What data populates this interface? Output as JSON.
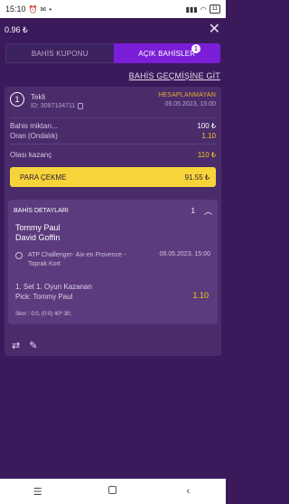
{
  "status_bar": {
    "time": "15:10",
    "battery": "11"
  },
  "top_bar": {
    "balance": "0.96 ₺"
  },
  "tabs": [
    {
      "label": "BAHİS KUPONU"
    },
    {
      "label": "AÇIK BAHİSLER",
      "badge": "1"
    }
  ],
  "history_link": "BAHİS GEÇMİŞİNE GİT",
  "bet": {
    "count": "1",
    "type": "Tekli",
    "id": "ID: 3097104711",
    "status": "HESAPLANMAYAN",
    "date": "06.05.2023, 15:00",
    "stake_label": "Bahis miktarı...",
    "stake_value": "100 ₺",
    "odds_label": "Oran (Ondalık)",
    "odds_value": "1.10",
    "potential_label": "Olası kazanç",
    "potential_value": "110 ₺",
    "cashout_label": "PARA ÇEKME",
    "cashout_value": "91.55 ₺"
  },
  "details": {
    "title": "BAHİS DETAYLARI",
    "count": "1",
    "team1": "Tommy Paul",
    "team2": "David Goffin",
    "event": "ATP Challenger- Aix-en Provence - Toprak Kort",
    "event_date": "06.05.2023, 15:00",
    "market": "1. Set 1. Oyun Kazanan",
    "pick": "Pick: Tommy Paul",
    "pick_odd": "1.10",
    "score": "Skor : 0:0, (0:0) 40*:30;"
  },
  "colors": {
    "background": "#3b1a5c",
    "accent": "#7b1ed8",
    "cashout": "#f7d43a",
    "status": "#f0a830"
  }
}
